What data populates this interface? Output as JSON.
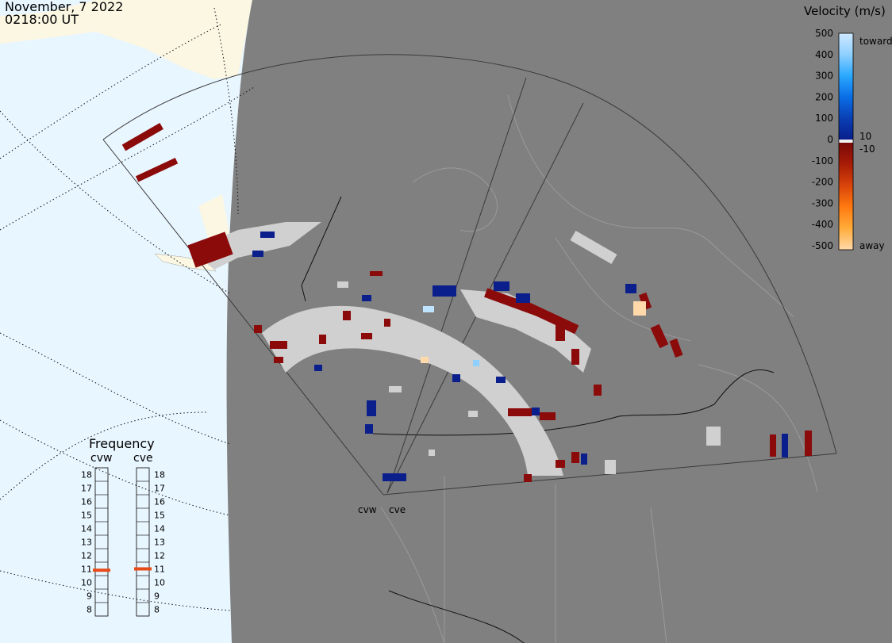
{
  "header": {
    "date": "November, 7 2022",
    "time": "0218:00 UT"
  },
  "colorbar": {
    "title": "Velocity (m/s)",
    "ticks": [
      "500",
      "400",
      "300",
      "200",
      "100",
      "0",
      "-100",
      "-200",
      "-300",
      "-400",
      "-500"
    ],
    "label_toward": "toward",
    "label_away": "away",
    "label_pos10": "10",
    "label_neg10": "-10",
    "colors": {
      "toward": [
        "#cfe9ff",
        "#8fd0ff",
        "#2aa8ff",
        "#0a6ee6",
        "#0a3fb4",
        "#0a1e8c"
      ],
      "away": [
        "#7a0a0a",
        "#a81c06",
        "#d8440a",
        "#ff7a10",
        "#ffac3a",
        "#ffd9aa"
      ]
    }
  },
  "frequency": {
    "title": "Frequency",
    "left_radar": "cvw",
    "right_radar": "cve",
    "scale": [
      "18",
      "17",
      "16",
      "15",
      "14",
      "13",
      "12",
      "11",
      "10",
      "9",
      "8"
    ],
    "cvw_mhz": 10.9,
    "cve_mhz": 11.0,
    "marker_color": "#e84a1a"
  },
  "map": {
    "ocean_color": "#e8f6ff",
    "land_unlit_color": "#808080",
    "land_lit_color": "#fbf7e3",
    "radar_labels": [
      "cvw",
      "cve"
    ],
    "gs_color": "#d0d0d0"
  }
}
